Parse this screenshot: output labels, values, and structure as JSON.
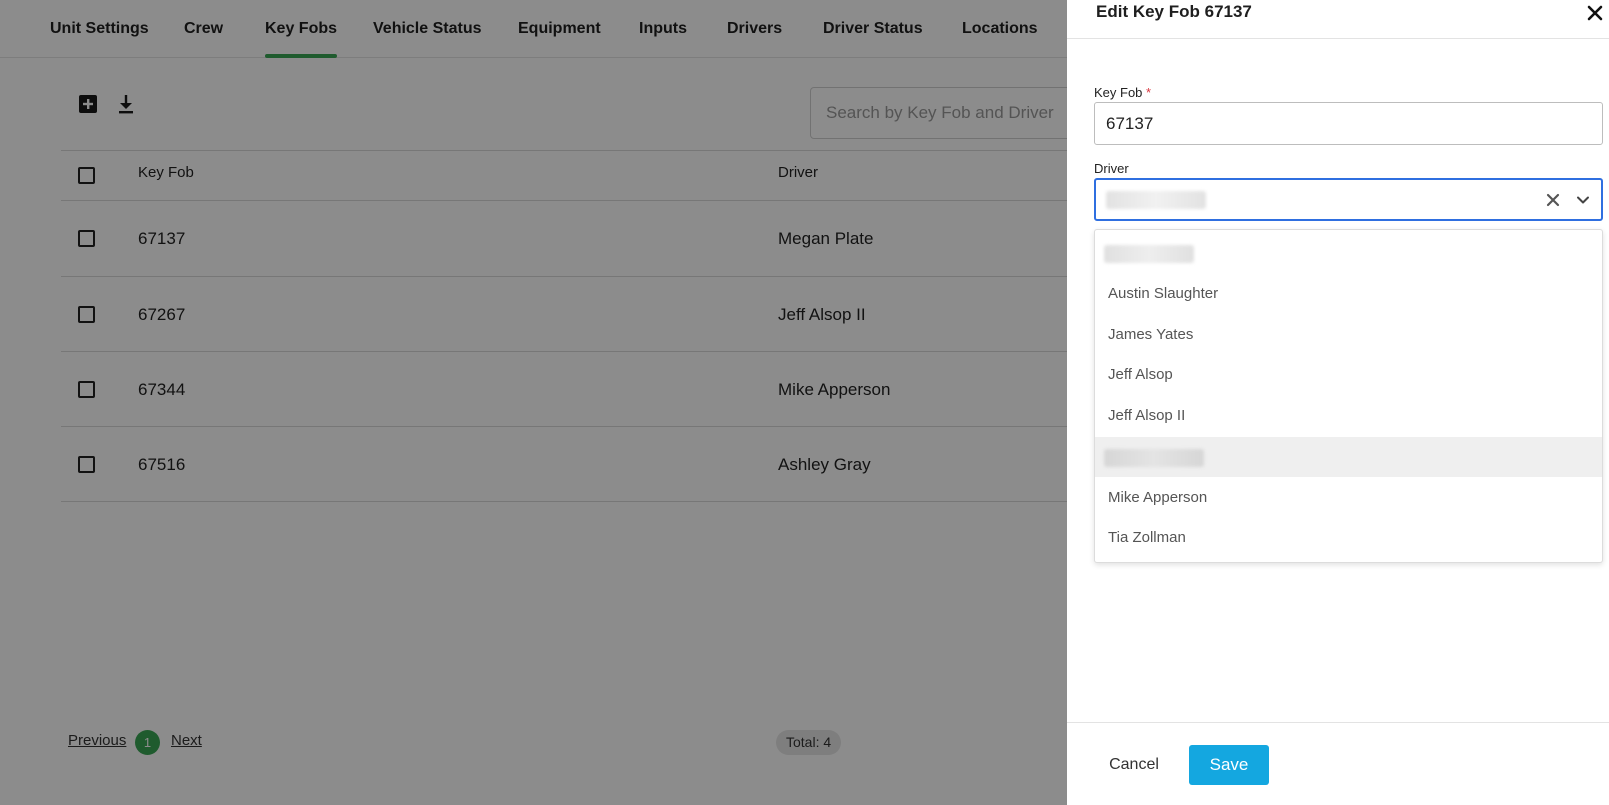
{
  "tabs": [
    {
      "label": "Unit Settings"
    },
    {
      "label": "Crew"
    },
    {
      "label": "Key Fobs",
      "active": true
    },
    {
      "label": "Vehicle Status"
    },
    {
      "label": "Equipment"
    },
    {
      "label": "Inputs"
    },
    {
      "label": "Drivers"
    },
    {
      "label": "Driver Status"
    },
    {
      "label": "Locations"
    }
  ],
  "toolbar": {
    "add_icon": "plus-square-icon",
    "download_icon": "download-icon",
    "search_placeholder": "Search by Key Fob and Driver"
  },
  "table": {
    "columns": [
      "Key Fob",
      "Driver"
    ],
    "rows": [
      {
        "key_fob": "67137",
        "driver": "Megan Plate"
      },
      {
        "key_fob": "67267",
        "driver": "Jeff Alsop II"
      },
      {
        "key_fob": "67344",
        "driver": "Mike Apperson"
      },
      {
        "key_fob": "67516",
        "driver": "Ashley Gray"
      }
    ]
  },
  "pagination": {
    "previous": "Previous",
    "current_page": "1",
    "next": "Next",
    "total": "Total: 4"
  },
  "drawer": {
    "title": "Edit Key Fob 67137",
    "close_icon": "close-icon",
    "key_fob_label": "Key Fob",
    "required_mark": "*",
    "key_fob_value": "67137",
    "driver_label": "Driver",
    "driver_options": [
      {
        "label": "",
        "redacted": true
      },
      {
        "label": "Austin Slaughter"
      },
      {
        "label": "James Yates"
      },
      {
        "label": "Jeff Alsop"
      },
      {
        "label": "Jeff Alsop II"
      },
      {
        "label": "",
        "redacted": true,
        "highlighted": true
      },
      {
        "label": "Mike Apperson"
      },
      {
        "label": "Tia Zollman"
      }
    ],
    "cancel_label": "Cancel",
    "save_label": "Save"
  },
  "colors": {
    "accent_green": "#3aa655",
    "save_blue": "#14a7e0",
    "focus_blue": "#2f6fe0",
    "required_red": "#d9363e"
  }
}
